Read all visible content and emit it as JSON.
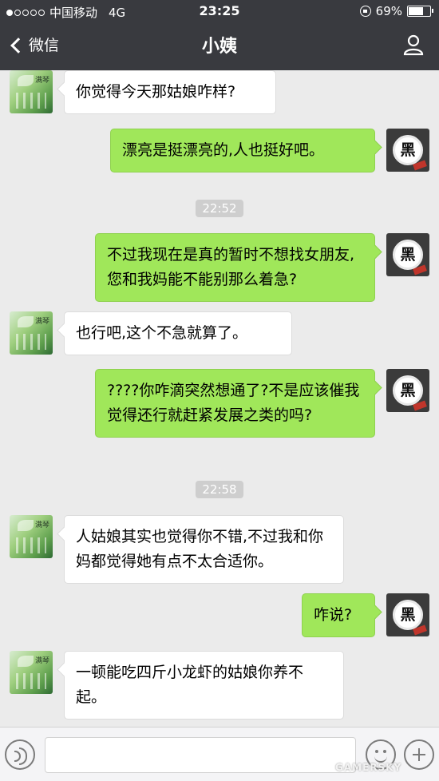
{
  "status_bar": {
    "carrier": "中国移动",
    "network": "4G",
    "time": "23:25",
    "battery": "69%",
    "battery_level": 0.69
  },
  "nav": {
    "back_label": "微信",
    "title": "小姨"
  },
  "messages": [
    {
      "side": "left",
      "text": "你觉得今天那姑娘咋样?"
    },
    {
      "side": "right",
      "text": "漂亮是挺漂亮的,人也挺好吧。"
    },
    {
      "time": "22:52"
    },
    {
      "side": "right",
      "text": "不过我现在是真的暂时不想找女朋友,您和我妈能不能别那么着急?"
    },
    {
      "side": "left",
      "text": "也行吧,这个不急就算了。"
    },
    {
      "side": "right",
      "text": "????你咋滴突然想通了?不是应该催我觉得还行就赶紧发展之类的吗?"
    },
    {
      "time": "22:58"
    },
    {
      "side": "left",
      "text": "人姑娘其实也觉得你不错,不过我和你妈都觉得她有点不太合适你。"
    },
    {
      "side": "right",
      "text": "咋说?"
    },
    {
      "side": "left",
      "text": "一顿能吃四斤小龙虾的姑娘你养不起。"
    }
  ],
  "avatars": {
    "aunt_glyph": "满琴",
    "me_glyph": "黑"
  },
  "watermark": "GAMERSKY",
  "colors": {
    "nav_bg": "#393a3f",
    "chat_bg": "#ebebeb",
    "sent_bubble": "#a0e75a",
    "recv_bubble": "#ffffff"
  },
  "icons": {
    "back": "chevron-left-icon",
    "profile": "person-icon",
    "voice": "voice-icon",
    "emoji": "emoji-icon",
    "plus": "plus-icon"
  }
}
